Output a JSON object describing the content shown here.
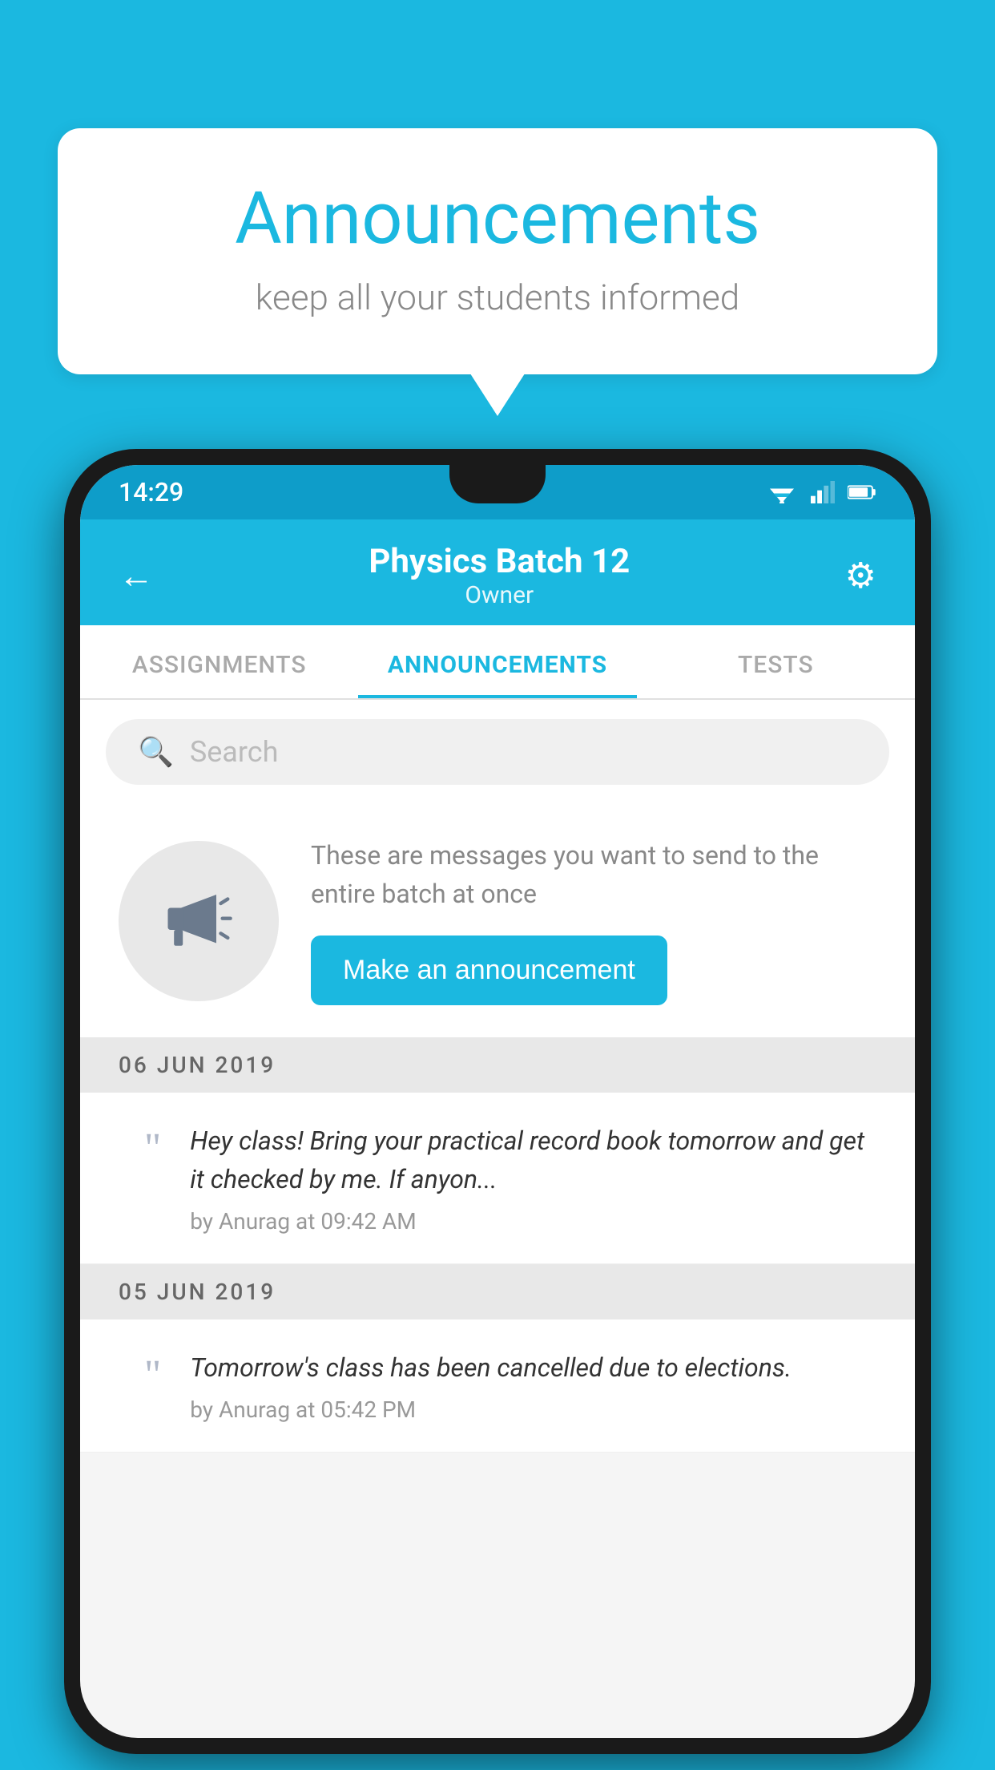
{
  "background_color": "#1bb8e0",
  "speech_bubble": {
    "title": "Announcements",
    "subtitle": "keep all your students informed"
  },
  "phone": {
    "status_bar": {
      "time": "14:29"
    },
    "header": {
      "title": "Physics Batch 12",
      "subtitle": "Owner",
      "back_label": "←",
      "settings_label": "⚙"
    },
    "tabs": [
      {
        "label": "ASSIGNMENTS",
        "active": false
      },
      {
        "label": "ANNOUNCEMENTS",
        "active": true
      },
      {
        "label": "TESTS",
        "active": false
      }
    ],
    "search": {
      "placeholder": "Search"
    },
    "announcement_prompt": {
      "description": "These are messages you want to send to the entire batch at once",
      "button_label": "Make an announcement"
    },
    "date_sections": [
      {
        "date": "06  JUN  2019",
        "items": [
          {
            "text": "Hey class! Bring your practical record book tomorrow and get it checked by me. If anyon...",
            "author": "by Anurag at 09:42 AM"
          }
        ]
      },
      {
        "date": "05  JUN  2019",
        "items": [
          {
            "text": "Tomorrow's class has been cancelled due to elections.",
            "author": "by Anurag at 05:42 PM"
          }
        ]
      }
    ]
  }
}
